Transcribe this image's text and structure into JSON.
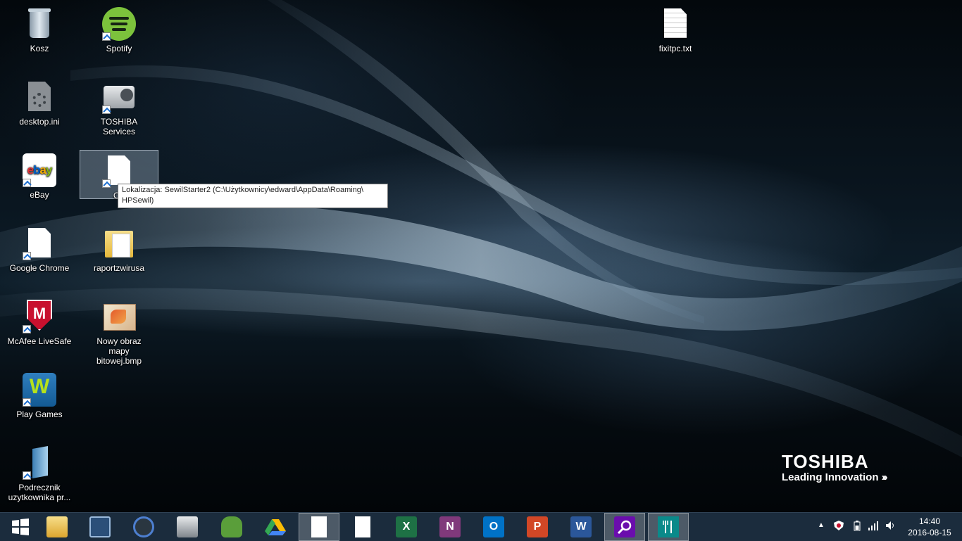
{
  "desktop_icons": [
    {
      "label": "Kosz",
      "icon": "recycle-bin-icon"
    },
    {
      "label": "Spotify",
      "icon": "spotify-icon"
    },
    {
      "label": "fixitpc.txt",
      "icon": "text-file-icon"
    },
    {
      "label": "desktop.ini",
      "icon": "settings-file-icon"
    },
    {
      "label": "TOSHIBA Services",
      "icon": "toshiba-services-icon"
    },
    {
      "label": "eBay",
      "icon": "ebay-icon"
    },
    {
      "label": "Op",
      "icon": "blank-shortcut-icon"
    },
    {
      "label": "Google Chrome",
      "icon": "blank-shortcut-icon"
    },
    {
      "label": "raportzwirusa",
      "icon": "folder-icon"
    },
    {
      "label": "McAfee LiveSafe",
      "icon": "mcafee-icon"
    },
    {
      "label": "Nowy obraz mapy bitowej.bmp",
      "icon": "bitmap-image-icon"
    },
    {
      "label": "Play Games",
      "icon": "play-games-icon"
    },
    {
      "label": "Podrecznik uzytkownika pr...",
      "icon": "manual-book-icon"
    }
  ],
  "tooltip": {
    "text": "Lokalizacja: SewilStarter2 (C:\\Użytkownicy\\edward\\AppData\\Roaming\\ HPSewil)"
  },
  "brand": {
    "name": "TOSHIBA",
    "slogan": "Leading Innovation"
  },
  "taskbar": {
    "items": [
      {
        "icon": "windows-start-icon"
      },
      {
        "icon": "file-explorer-icon"
      },
      {
        "icon": "remote-desktop-icon"
      },
      {
        "icon": "app-launcher-icon"
      },
      {
        "icon": "toshiba-services-icon"
      },
      {
        "icon": "evernote-icon"
      },
      {
        "icon": "google-drive-icon"
      },
      {
        "icon": "blank-file-icon",
        "active": true
      },
      {
        "icon": "blank-file-icon"
      },
      {
        "icon": "excel-icon",
        "letter": "X"
      },
      {
        "icon": "onenote-icon",
        "letter": "N"
      },
      {
        "icon": "outlook-icon",
        "letter": "O"
      },
      {
        "icon": "powerpoint-icon",
        "letter": "P"
      },
      {
        "icon": "word-icon",
        "letter": "W"
      },
      {
        "icon": "search-icon",
        "active": true
      },
      {
        "icon": "food-drink-icon",
        "active": true
      }
    ],
    "tray": {
      "clock_time": "14:40",
      "clock_date": "2016-08-15"
    }
  },
  "colors": {
    "taskbar": "#1b2c3d",
    "excel": "#1e7145",
    "onenote": "#80397b",
    "outlook": "#0072c6",
    "powerpoint": "#d24726",
    "word": "#2b579a",
    "search_app": "#6a0dad",
    "food_app": "#0a8a8a"
  }
}
